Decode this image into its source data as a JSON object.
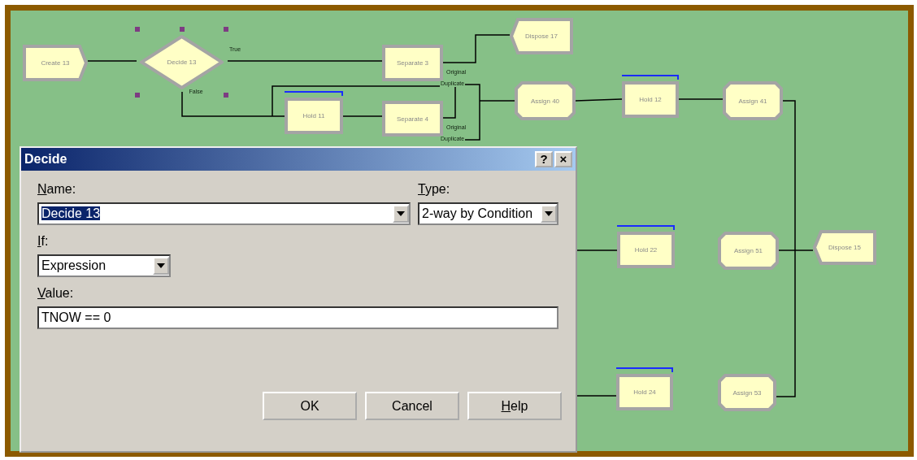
{
  "diagram": {
    "nodes": [
      {
        "kind": "create",
        "label": "Create 13",
        "selected": false
      },
      {
        "kind": "decide",
        "label": "Decide 13",
        "selected": true,
        "ports": [
          "True",
          "False"
        ]
      },
      {
        "kind": "separate",
        "label": "Separate 3",
        "selected": false,
        "ports": [
          "Original",
          "Duplicate"
        ]
      },
      {
        "kind": "dispose",
        "label": "Dispose 17",
        "selected": false
      },
      {
        "kind": "hold",
        "label": "Hold 11",
        "selected": false
      },
      {
        "kind": "separate",
        "label": "Separate 4",
        "selected": false,
        "ports": [
          "Original",
          "Duplicate"
        ]
      },
      {
        "kind": "assign",
        "label": "Assign 40",
        "selected": false
      },
      {
        "kind": "hold",
        "label": "Hold 12",
        "selected": false
      },
      {
        "kind": "assign",
        "label": "Assign 41",
        "selected": false
      },
      {
        "kind": "hold",
        "label": "Hold 22",
        "selected": false
      },
      {
        "kind": "assign",
        "label": "Assign 51",
        "selected": false
      },
      {
        "kind": "dispose",
        "label": "Dispose 15",
        "selected": false
      },
      {
        "kind": "hold",
        "label": "Hold 24",
        "selected": false
      },
      {
        "kind": "assign",
        "label": "Assign 53",
        "selected": false
      }
    ]
  },
  "dialog": {
    "title": "Decide",
    "title_buttons": [
      "?",
      "×"
    ],
    "fields": [
      {
        "kind": "combo",
        "label": "Name:",
        "value": "Decide 13",
        "text_selected": true
      },
      {
        "kind": "combo",
        "label": "Type:",
        "value": "2-way by Condition",
        "text_selected": false
      },
      {
        "kind": "combo",
        "label": "If:",
        "value": "Expression",
        "text_selected": false
      },
      {
        "kind": "text",
        "label": "Value:",
        "value": "TNOW == 0",
        "text_selected": false
      }
    ],
    "buttons": [
      {
        "label": "OK",
        "mnemonic": false
      },
      {
        "label": "Cancel",
        "mnemonic": false
      },
      {
        "label": "Help",
        "mnemonic": true
      }
    ]
  }
}
